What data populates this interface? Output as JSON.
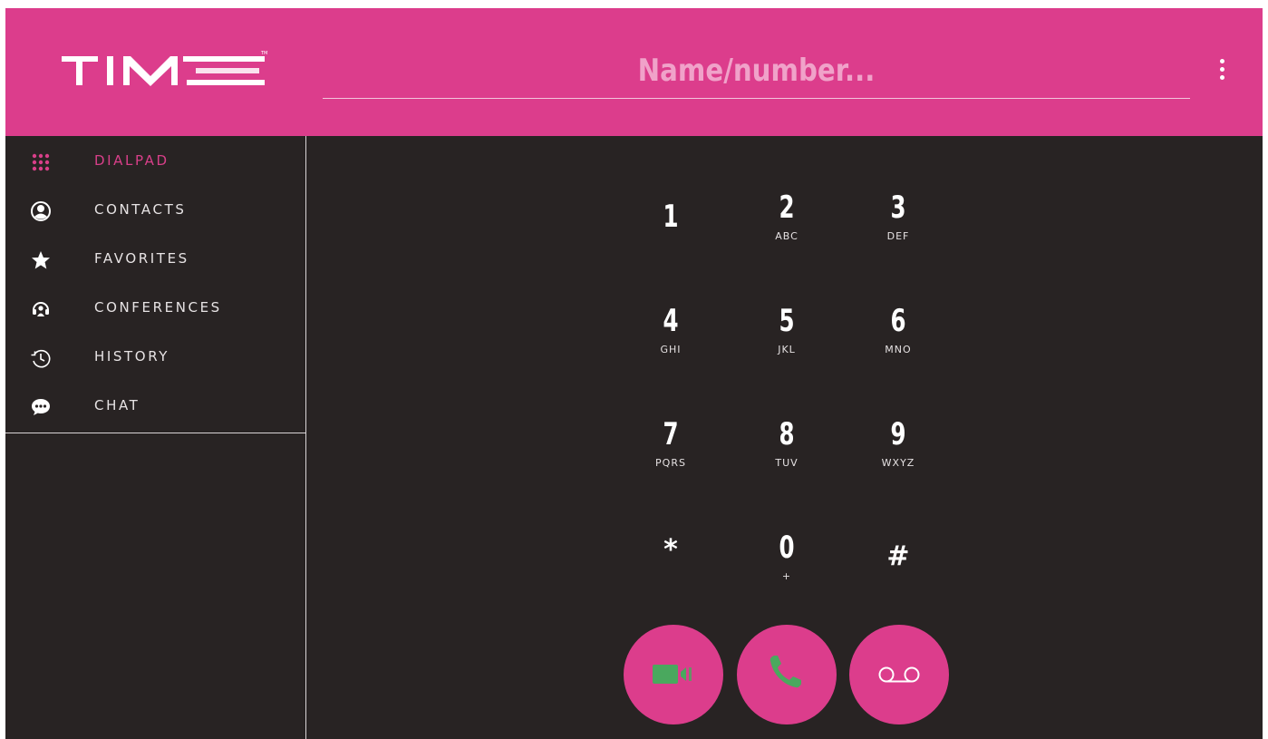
{
  "header": {
    "brand": "TIME",
    "search_placeholder": "Name/number...",
    "menu_icon": "more-vertical-icon",
    "colors": {
      "header_bg": "#dc3d8c",
      "accent": "#d83f89",
      "panel_bg": "#282323",
      "call_green": "#4aa85e"
    }
  },
  "sidebar": {
    "items": [
      {
        "label": "DIALPAD",
        "icon": "dialpad-grid-icon",
        "active": true
      },
      {
        "label": "CONTACTS",
        "icon": "user-circle-icon",
        "active": false
      },
      {
        "label": "FAVORITES",
        "icon": "star-icon",
        "active": false
      },
      {
        "label": "CONFERENCES",
        "icon": "conference-headset-icon",
        "active": false
      },
      {
        "label": "HISTORY",
        "icon": "history-clock-icon",
        "active": false
      },
      {
        "label": "CHAT",
        "icon": "chat-bubble-icon",
        "active": false
      }
    ]
  },
  "dialpad": {
    "keys": [
      {
        "digit": "1",
        "letters": ""
      },
      {
        "digit": "2",
        "letters": "ABC"
      },
      {
        "digit": "3",
        "letters": "DEF"
      },
      {
        "digit": "4",
        "letters": "GHI"
      },
      {
        "digit": "5",
        "letters": "JKL"
      },
      {
        "digit": "6",
        "letters": "MNO"
      },
      {
        "digit": "7",
        "letters": "PQRS"
      },
      {
        "digit": "8",
        "letters": "TUV"
      },
      {
        "digit": "9",
        "letters": "WXYZ"
      },
      {
        "digit": "*",
        "letters": ""
      },
      {
        "digit": "0",
        "letters": "+"
      },
      {
        "digit": "#",
        "letters": ""
      }
    ],
    "actions": [
      {
        "name": "video-call-button",
        "icon": "video-camera-icon"
      },
      {
        "name": "call-button",
        "icon": "phone-icon"
      },
      {
        "name": "voicemail-button",
        "icon": "voicemail-icon"
      }
    ]
  }
}
